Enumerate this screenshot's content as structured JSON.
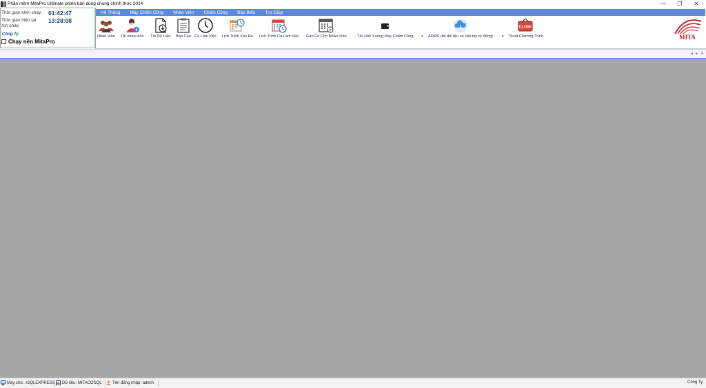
{
  "window": {
    "title": "Phần mềm MitaPro Ultimate phiên bản dùng chung chính thức 2024",
    "controls": {
      "minimize": "—",
      "restore": "❐",
      "close": "✕"
    }
  },
  "info_panel": {
    "startup_label": "Thời gian khởi chạy:",
    "startup_time": "01:42:47",
    "current_label": "Thời gian hiện tại:",
    "current_time": "13:28:08",
    "greeting": "Xin chào",
    "company": "Công Ty",
    "background_run": "Chạy nền MitaPro"
  },
  "menu": [
    "Hệ Thống",
    "Máy Chấm Công",
    "Nhân Viên",
    "Chấm Công",
    "Báo Biểu",
    "Trợ Giúp"
  ],
  "toolbar": [
    {
      "label": "Nhân Viên",
      "icon": "employees-icon"
    },
    {
      "label": "Tải nhân viên",
      "icon": "download-employee-icon"
    },
    {
      "label": "Tải Dữ Liệu",
      "icon": "download-data-icon"
    },
    {
      "label": "Báo Cáo",
      "icon": "report-icon"
    },
    {
      "label": "Ca Làm Việc",
      "icon": "clock-icon"
    },
    {
      "label": "Lịch Trình Vào Ra",
      "icon": "schedule-inout-icon"
    },
    {
      "label": "Lịch Trình Ca Làm Việc",
      "icon": "shift-calendar-icon"
    },
    {
      "label": "Gán Ca Cho Nhân Viên",
      "icon": "assign-shift-icon"
    },
    {
      "label": "Tải Lên/ Xuống Máy Chấm Công",
      "icon": "device-sync-icon"
    },
    {
      "label": "ADMS (tải dữ liệu và vân tay tự động)",
      "icon": "cloud-icon"
    },
    {
      "label": "Thoát Chương Trình",
      "icon": "close-sign-icon"
    }
  ],
  "logo_text": "MITA",
  "logo_close_text": "CLOSE",
  "tabnav": {
    "prev": "◂",
    "next": "▸",
    "close": "✕"
  },
  "statusbar": {
    "server": "Máy chủ: .\\SQLEXPRESS",
    "database": "Dữ liệu: MITACOSQL",
    "user": "Tên đăng nhập: admin",
    "company": "Công Ty"
  },
  "colors": {
    "menubar": "#5b8bd6",
    "workspace": "#a7a7a7",
    "clock": "#1f3d66",
    "logo_red": "#c0262c"
  }
}
